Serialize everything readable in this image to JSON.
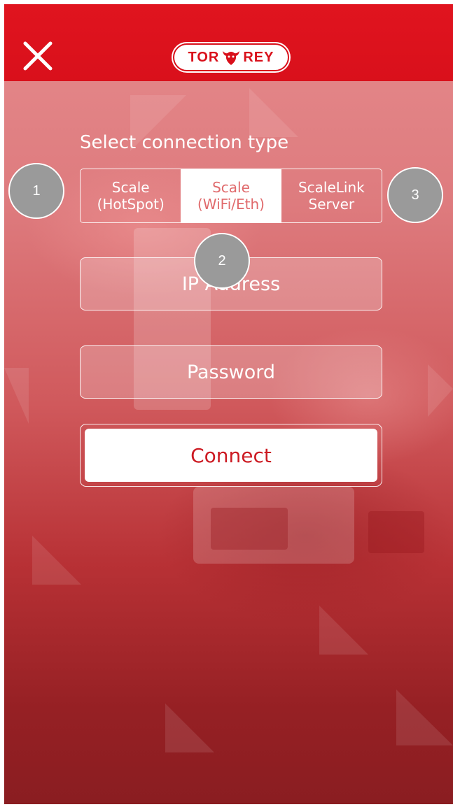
{
  "header": {
    "close_icon": "close-icon",
    "logo": {
      "left": "TOR",
      "right": "REY",
      "mark_icon": "bull-head-icon"
    }
  },
  "form": {
    "title": "Select connection type",
    "segments": [
      {
        "line1": "Scale",
        "line2": "(HotSpot)",
        "selected": false
      },
      {
        "line1": "Scale",
        "line2": "(WiFi/Eth)",
        "selected": true
      },
      {
        "line1": "ScaleLink",
        "line2": "Server",
        "selected": false
      }
    ],
    "ip_placeholder": "IP Address",
    "password_placeholder": "Password",
    "connect_label": "Connect"
  },
  "markers": [
    "1",
    "2",
    "3"
  ],
  "colors": {
    "brand_red": "#d9101b",
    "connect_text": "#cc1a22",
    "marker_gray": "#9a9a9a"
  }
}
